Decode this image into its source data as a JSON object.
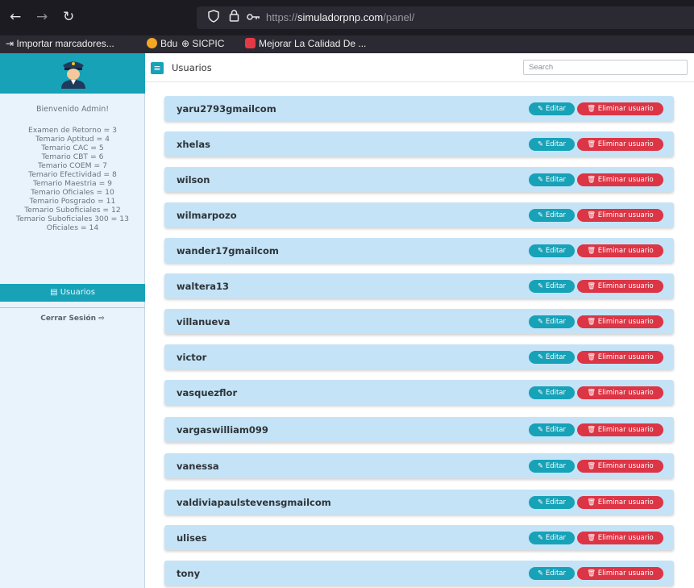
{
  "browser": {
    "url_prefix": "https://",
    "url_domain": "simuladorpnp.com",
    "url_path": "/panel/",
    "bookmarks": [
      {
        "label": "Importar marcadores...",
        "color": ""
      },
      {
        "label": "Bdu",
        "color": "#f5a623"
      },
      {
        "label": "SICPIC",
        "color": ""
      },
      {
        "label": "Mejorar La Calidad De ...",
        "color": "#e63946"
      }
    ]
  },
  "sidebar": {
    "welcome": "Bienvenido Admin!",
    "stats": [
      "Examen de Retorno = 3",
      "Temario Aptitud = 4",
      "Temario CAC = 5",
      "Temario CBT = 6",
      "Temario COEM = 7",
      "Temario Efectividad = 8",
      "Temario Maestria = 9",
      "Temario Oficiales = 10",
      "Temario Posgrado = 11",
      "Temario Suboficiales = 12",
      "Temario Suboficiales 300 = 13",
      "Oficiales = 14"
    ],
    "nav_usuarios": "Usuarios",
    "logout": "Cerrar Sesión"
  },
  "header": {
    "title": "Usuarios",
    "search_placeholder": "Search"
  },
  "actions": {
    "edit": "Editar",
    "delete": "Eliminar usuario"
  },
  "users": [
    "yaru2793gmailcom",
    "xhelas",
    "wilson",
    "wilmarpozo",
    "wander17gmailcom",
    "waltera13",
    "villanueva",
    "victor",
    "vasquezflor",
    "vargaswilliam099",
    "vanessa",
    "valdiviapaulstevensgmailcom",
    "ulises",
    "tony"
  ],
  "colors": {
    "accent": "#17a2b8",
    "danger": "#dc3545",
    "row_bg": "#c5e3f6"
  }
}
